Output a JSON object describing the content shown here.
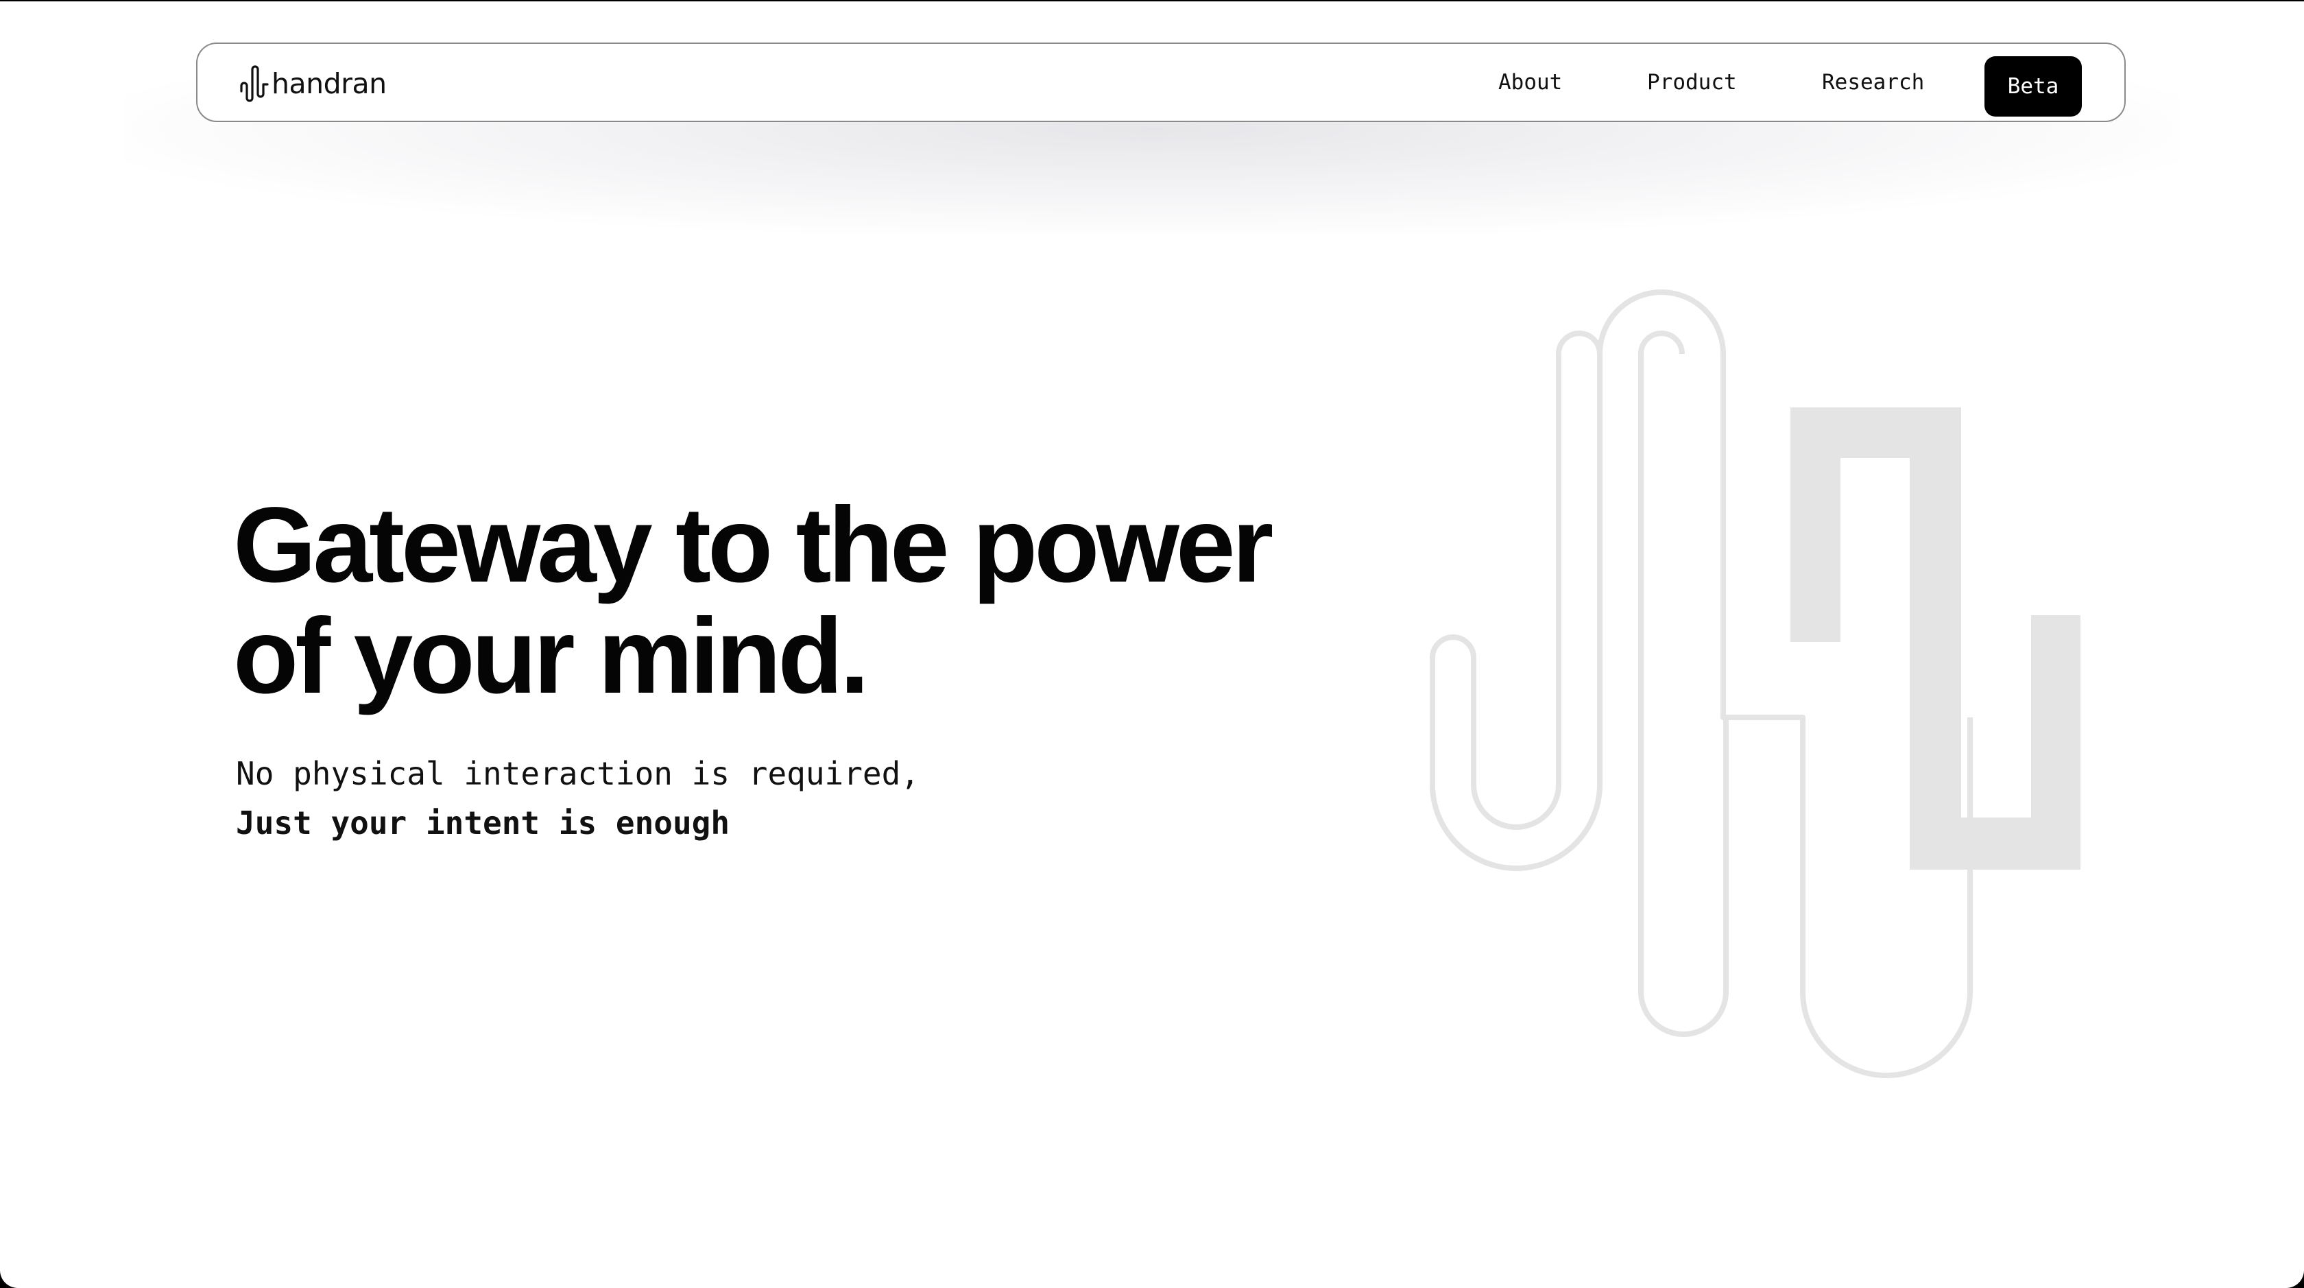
{
  "brand": {
    "name": "handran",
    "logo_icon": "wave-logo-icon"
  },
  "nav": {
    "items": [
      {
        "label": "About"
      },
      {
        "label": "Product"
      },
      {
        "label": "Research"
      }
    ],
    "cta_label": "Beta"
  },
  "hero": {
    "title_line1": "Gateway to the power",
    "title_line2": "of your mind.",
    "subtitle_line1": "No physical interaction is required,",
    "subtitle_line2": "Just your intent is enough"
  },
  "decoration": {
    "icon": "brand-wave-graphic",
    "color": "#e4e4e4"
  },
  "colors": {
    "background": "#ffffff",
    "text": "#050505",
    "cta_background": "#000000",
    "cta_text": "#ffffff",
    "nav_border": "#8a8a8a"
  }
}
